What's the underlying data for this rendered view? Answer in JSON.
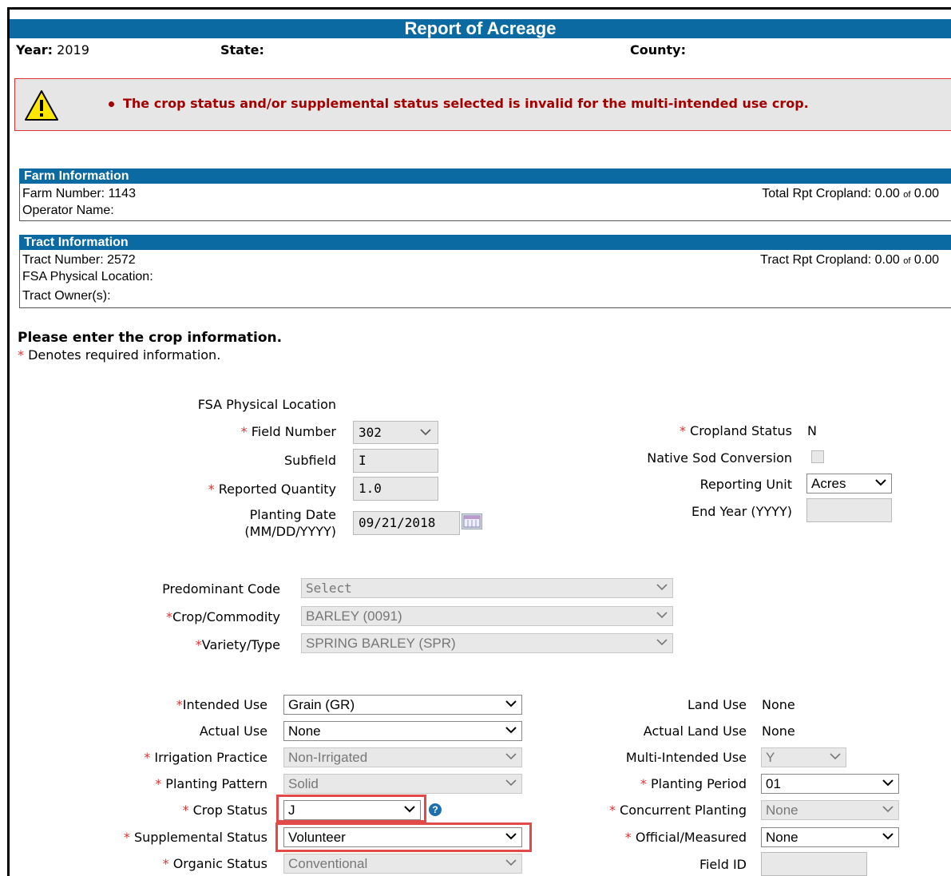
{
  "title": "Report of Acreage",
  "header": {
    "year_label": "Year:",
    "year_value": "2019",
    "state_label": "State:",
    "county_label": "County:"
  },
  "alert": {
    "icon": "warning-triangle-icon",
    "message": "The crop status and/or supplemental status selected is invalid for the multi-intended use crop."
  },
  "farm": {
    "heading": "Farm Information",
    "number": "Farm Number: 1143",
    "operator": "Operator Name:",
    "cropland_label": "Total Rpt Cropland: 0.00",
    "of": "of",
    "cropland_total": "0.00"
  },
  "tract": {
    "heading": "Tract Information",
    "number": "Tract Number: 2572",
    "location": "FSA Physical Location:",
    "owners": "Tract Owner(s):",
    "cropland_label": "Tract Rpt Cropland: 0.00",
    "of": "of",
    "cropland_total": "0.00"
  },
  "instructions": {
    "heading": "Please enter the crop information.",
    "required_note": "Denotes required information.",
    "asterisk": "*"
  },
  "form": {
    "fsa_location_label": "FSA Physical Location",
    "field_number": {
      "label": "Field Number",
      "value": "302"
    },
    "subfield": {
      "label": "Subfield",
      "value": "I"
    },
    "reported_quantity": {
      "label": "Reported Quantity",
      "value": "1.0"
    },
    "planting_date": {
      "label_1": "Planting Date",
      "label_2": "(MM/DD/YYYY)",
      "value": "09/21/2018"
    },
    "cropland_status": {
      "label": "Cropland Status",
      "value": "N"
    },
    "native_sod": {
      "label": "Native Sod Conversion"
    },
    "reporting_unit": {
      "label": "Reporting Unit",
      "value": "Acres"
    },
    "end_year": {
      "label": "End Year (YYYY)",
      "value": ""
    },
    "predominant_code": {
      "label": "Predominant Code",
      "value": "Select"
    },
    "crop_commodity": {
      "label": "Crop/Commodity",
      "value": "BARLEY (0091)"
    },
    "variety_type": {
      "label": "Variety/Type",
      "value": "SPRING BARLEY (SPR)"
    },
    "intended_use": {
      "label": "Intended Use",
      "value": "Grain (GR)"
    },
    "actual_use": {
      "label": "Actual Use",
      "value": "None"
    },
    "irrigation_practice": {
      "label": "Irrigation Practice",
      "value": "Non-Irrigated"
    },
    "planting_pattern": {
      "label": "Planting Pattern",
      "value": "Solid"
    },
    "crop_status": {
      "label": "Crop Status",
      "value": "J"
    },
    "supplemental_status": {
      "label": "Supplemental Status",
      "value": "Volunteer"
    },
    "organic_status": {
      "label": "Organic Status",
      "value": "Conventional"
    },
    "land_use": {
      "label": "Land Use",
      "value": "None"
    },
    "actual_land_use": {
      "label": "Actual Land Use",
      "value": "None"
    },
    "multi_intended_use": {
      "label": "Multi-Intended Use",
      "value": "Y"
    },
    "planting_period": {
      "label": "Planting Period",
      "value": "01"
    },
    "concurrent_planting": {
      "label": "Concurrent Planting",
      "value": "None"
    },
    "official_measured": {
      "label": "Official/Measured",
      "value": "None"
    },
    "field_id": {
      "label": "Field ID",
      "value": ""
    },
    "help_glyph": "?"
  },
  "colors": {
    "accent": "#0a6aa1",
    "error": "#a40000",
    "highlight": "#e24a4a"
  }
}
